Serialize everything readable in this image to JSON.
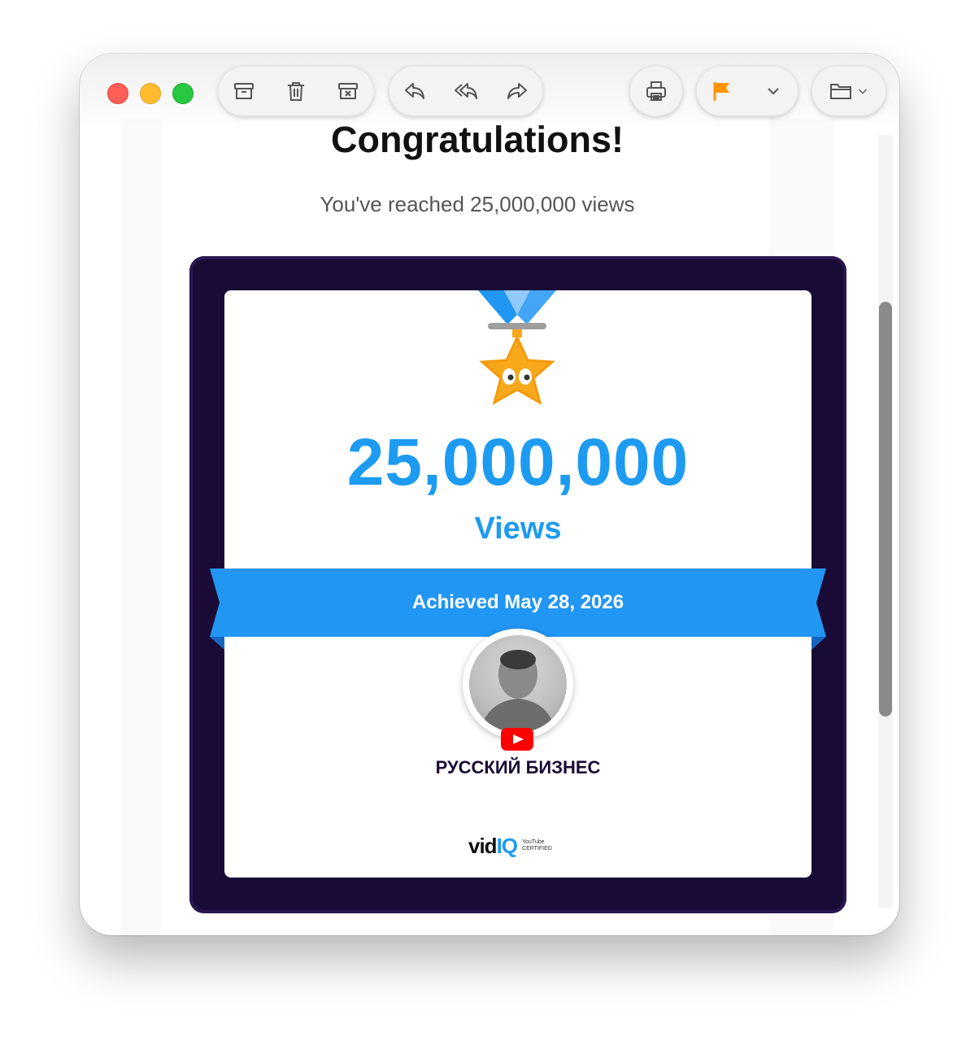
{
  "toolbar": {
    "archive_icon": "archive-icon",
    "trash_icon": "trash-icon",
    "junk_icon": "junk-icon",
    "reply_icon": "reply-icon",
    "reply_all_icon": "reply-all-icon",
    "forward_icon": "forward-icon",
    "print_icon": "print-icon",
    "flag_icon": "flag-icon",
    "flag_color": "#ff9500",
    "folder_icon": "folder-icon"
  },
  "email": {
    "title": "Congratulations!",
    "subtitle": "You've reached 25,000,000 views",
    "milestone_number": "25,000,000",
    "milestone_label": "Views",
    "achieved_text": "Achieved May 28, 2026",
    "channel_name": "РУССКИЙ БИЗНЕС",
    "brand_prefix": "vid",
    "brand_suffix": "IQ",
    "yt_certified_top": "YouTube",
    "yt_certified_bottom": "CERTIFIED"
  },
  "colors": {
    "accent": "#1d9bf0",
    "frame": "#1a0b36",
    "medal": "#f7a81b",
    "ribbon": "#2196f3"
  }
}
